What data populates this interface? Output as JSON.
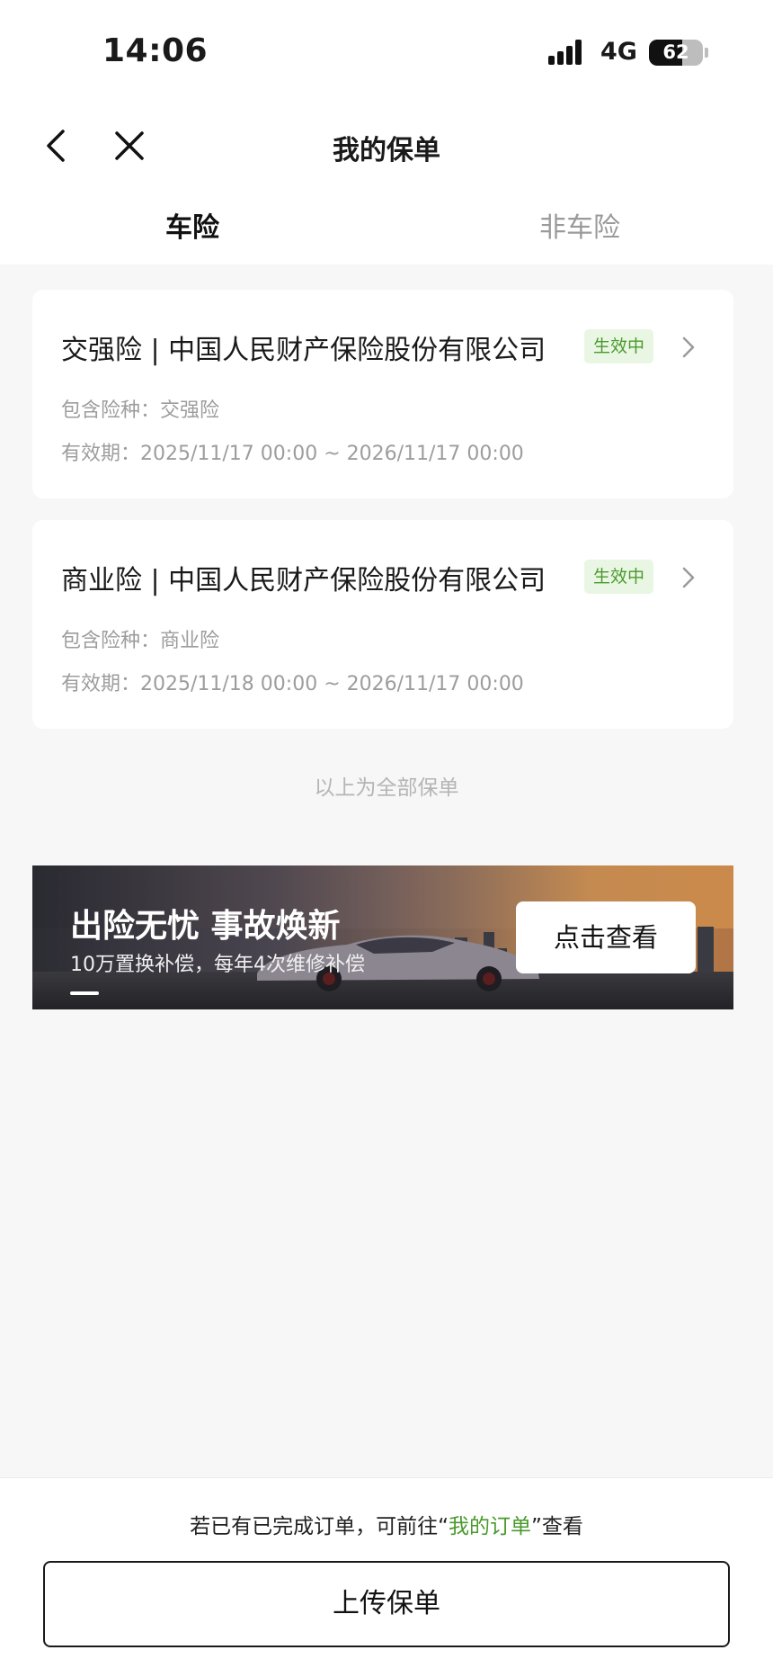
{
  "status_bar": {
    "time": "14:06",
    "network": "4G",
    "battery": "62",
    "battery_level": 0.62
  },
  "nav": {
    "title": "我的保单",
    "back_icon": "chevron-left-icon",
    "close_icon": "close-icon"
  },
  "tabs": [
    {
      "label": "车险",
      "active": true
    },
    {
      "label": "非车险",
      "active": false
    }
  ],
  "policies": [
    {
      "title": "交强险 | 中国人民财产保险股份有限公司",
      "status": "生效中",
      "coverage": "包含险种：交强险",
      "validity": "有效期：2025/11/17 00:00 ~ 2026/11/17 00:00"
    },
    {
      "title": "商业险 | 中国人民财产保险股份有限公司",
      "status": "生效中",
      "coverage": "包含险种：商业险",
      "validity": "有效期：2025/11/18 00:00 ~ 2026/11/17 00:00"
    }
  ],
  "end_note": "以上为全部保单",
  "banner": {
    "title": "出险无忧 事故焕新",
    "subtitle": "10万置换补偿，每年4次维修补偿",
    "button": "点击查看"
  },
  "footer": {
    "hint_prefix": "若已有已完成订单，可前往“",
    "hint_link": "我的订单",
    "hint_suffix": "”查看",
    "upload_button": "上传保单"
  },
  "colors": {
    "accent_green": "#4a9a2c",
    "badge_bg": "#eaf6e4",
    "page_bg": "#f7f7f7"
  }
}
